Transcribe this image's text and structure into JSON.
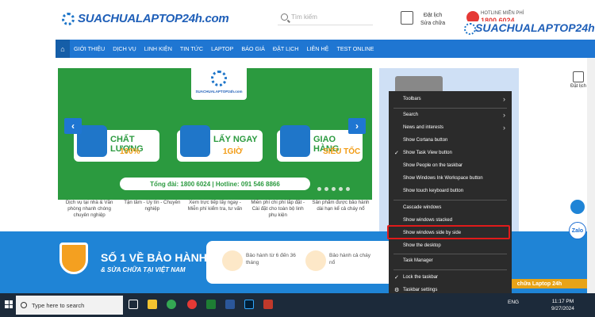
{
  "header": {
    "logo_text": "SUACHUALAPTOP24h.com",
    "search_placeholder": "Tìm kiếm",
    "booking_label_1": "Đặt lịch",
    "booking_label_2": "Sửa chữa",
    "hotline_label": "HOTLINE MIỄN PHÍ",
    "hotline_number": "1800 6024",
    "logo2_text": "SUACHUALAPTOP24h.com"
  },
  "nav": {
    "items": [
      "GIỚI THIỆU",
      "DỊCH VỤ",
      "LINH KIỆN",
      "TIN TỨC",
      "LAPTOP",
      "BÁO GIÁ",
      "ĐẶT LỊCH",
      "LIÊN HỆ",
      "TEST ONLINE"
    ]
  },
  "banner": {
    "logo_small": "SUACHUALAPTOP24h.com",
    "cards": [
      {
        "w1": "CHẤT LƯỢNG",
        "w2": "100%"
      },
      {
        "w1": "LẤY NGAY",
        "w2": "1GIỜ"
      },
      {
        "w1": "GIAO HÀNG",
        "w2": "SIÊU TỐC"
      }
    ],
    "hotline": "Tổng đài: 1800 6024   |   Hotline: 091 546 8866",
    "prev": "‹",
    "next": "›"
  },
  "captions": [
    "Dịch vụ tại nhà & Văn phòng nhanh chóng chuyên nghiệp",
    "Tận tâm - Uy tín - Chuyên nghiệp",
    "Xem trực tiếp lấy ngay - Miễn phí kiểm tra, tư vấn",
    "Miễn phí chi phí lắp đặt - Cài đặt cho toàn bộ linh phụ kiện",
    "Sản phẩm được bảo hành dài hạn kể cả cháy nổ"
  ],
  "side": {
    "booking": "Đặt lịch",
    "zalo": "Zalo"
  },
  "strip": {
    "title": "SỐ 1 VỀ BẢO HÀNH",
    "subtitle": "& SỬA CHỮA TẠI VIỆT NAM",
    "feature1": "Bảo hành từ 6 đến 36 tháng",
    "feature2": "Bảo hành cả cháy nổ",
    "cta": "chữa Laptop 24h"
  },
  "context_menu": {
    "items": [
      {
        "label": "Toolbars",
        "submenu": true
      },
      {
        "label": "Search",
        "submenu": true
      },
      {
        "label": "News and interests",
        "submenu": true
      },
      {
        "label": "Show Cortana button"
      },
      {
        "label": "Show Task View button",
        "checked": true
      },
      {
        "label": "Show People on the taskbar"
      },
      {
        "label": "Show Windows Ink Workspace button"
      },
      {
        "label": "Show touch keyboard button"
      },
      {
        "label": "Cascade windows"
      },
      {
        "label": "Show windows stacked"
      },
      {
        "label": "Show windows side by side",
        "highlighted": true
      },
      {
        "label": "Show the desktop"
      },
      {
        "label": "Task Manager"
      },
      {
        "label": "Lock the taskbar",
        "checked": true
      },
      {
        "label": "Taskbar settings",
        "icon": "gear-icon"
      }
    ]
  },
  "taskbar": {
    "search_placeholder": "Type here to search",
    "lang": "ENG",
    "time": "11:17 PM",
    "date": "9/27/2024"
  },
  "colors": {
    "nav_blue": "#1f76d2",
    "banner_green": "#2b9a3f",
    "menu_bg": "#2b2b2b",
    "highlight_red": "#e01b1b"
  }
}
